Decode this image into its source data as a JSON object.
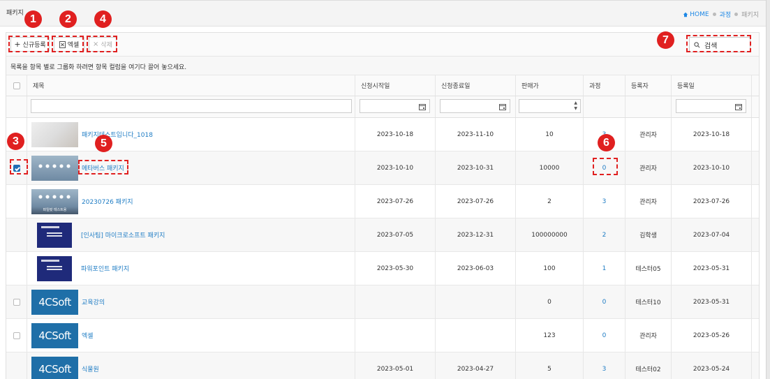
{
  "page": {
    "title": "패키지"
  },
  "breadcrumb": {
    "home": "HOME",
    "course": "과정",
    "current": "패키지"
  },
  "toolbar": {
    "new_label": "신규등록",
    "excel_label": "엑셀",
    "delete_label": "삭제"
  },
  "search": {
    "value": "검색"
  },
  "group_hint": "목록을 항목 별로 그룹화 하려면 항목 컬럼을 여기다 끌어 놓으세요.",
  "columns": {
    "title": "제목",
    "start": "신청시작일",
    "end": "신청종료일",
    "price": "판매가",
    "course": "과정",
    "registrant": "등록자",
    "date": "등록일"
  },
  "rows": [
    {
      "thumb": "sketch",
      "title": "패키지테스트입니다_1018",
      "start": "2023-10-18",
      "end": "2023-11-10",
      "price": "10",
      "course": "3",
      "registrant": "관리자",
      "date": "2023-10-18",
      "checked": false,
      "show_cb": false
    },
    {
      "thumb": "bulbs",
      "title": "메타버스 패키지",
      "start": "2023-10-10",
      "end": "2023-10-31",
      "price": "10000",
      "course": "0",
      "registrant": "관리자",
      "date": "2023-10-10",
      "checked": true,
      "show_cb": true
    },
    {
      "thumb": "bulbs-label",
      "thumb_text": "파일럿 테스트용",
      "title": "20230726 패키지",
      "start": "2023-07-26",
      "end": "2023-07-26",
      "price": "2",
      "course": "3",
      "registrant": "관리자",
      "date": "2023-07-26",
      "checked": false,
      "show_cb": false
    },
    {
      "thumb": "dark",
      "title": "[인사팀] 마이크로소프트 패키지",
      "start": "2023-07-05",
      "end": "2023-12-31",
      "price": "100000000",
      "course": "2",
      "registrant": "김학생",
      "date": "2023-07-04",
      "checked": false,
      "show_cb": false
    },
    {
      "thumb": "dark",
      "title": "파워포인트 패키지",
      "start": "2023-05-30",
      "end": "2023-06-03",
      "price": "100",
      "course": "1",
      "registrant": "테스터05",
      "date": "2023-05-31",
      "checked": false,
      "show_cb": false
    },
    {
      "thumb": "logo",
      "logo_text": "4CSoft",
      "title": "교육강의",
      "start": "",
      "end": "",
      "price": "0",
      "course": "0",
      "registrant": "테스터10",
      "date": "2023-05-31",
      "checked": false,
      "show_cb": true
    },
    {
      "thumb": "logo",
      "logo_text": "4CSoft",
      "title": "엑셀",
      "start": "",
      "end": "",
      "price": "123",
      "course": "0",
      "registrant": "관리자",
      "date": "2023-05-26",
      "checked": false,
      "show_cb": true
    },
    {
      "thumb": "logo",
      "logo_text": "4CSoft",
      "title": "식물원",
      "start": "2023-05-01",
      "end": "2023-04-27",
      "price": "5",
      "course": "3",
      "registrant": "테스터02",
      "date": "2023-05-24",
      "checked": false,
      "show_cb": false
    }
  ],
  "annotations": [
    "1",
    "2",
    "3",
    "4",
    "5",
    "6",
    "7"
  ],
  "colors": {
    "accent": "#1e7cc4",
    "annotation": "#e02020",
    "logo_bg": "#1f6fa8"
  }
}
